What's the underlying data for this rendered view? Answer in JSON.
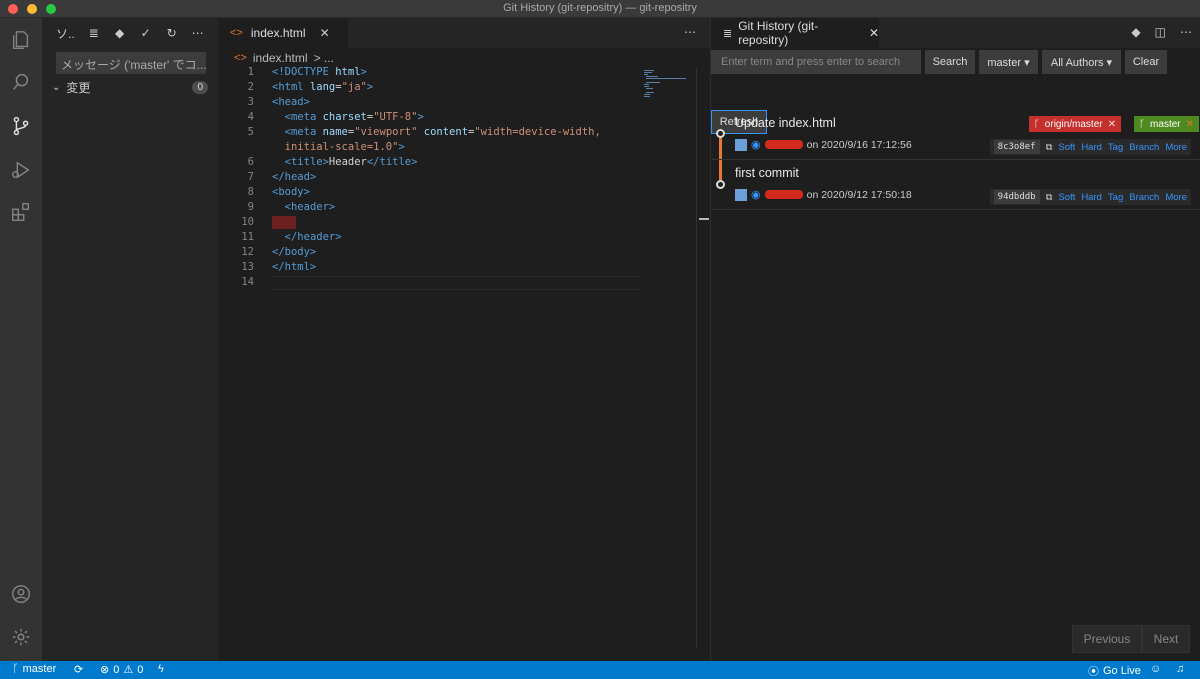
{
  "window": {
    "title": "Git History (git-repositry) — git-repositry"
  },
  "activity": {
    "icons": [
      "explorer-icon",
      "search-icon",
      "source-control-icon",
      "run-debug-icon",
      "extensions-icon",
      "account-icon",
      "settings-gear-icon"
    ]
  },
  "sidebar": {
    "header_label": "ソ..",
    "message_placeholder": "メッセージ ('master' でコ...",
    "changes_label": "変更",
    "changes_count": "0"
  },
  "editor": {
    "tab_label": "index.html",
    "breadcrumb_file": "index.html",
    "breadcrumb_more": "> ...",
    "lines": [
      {
        "n": "1",
        "html": "<span class='t'>&lt;!DOCTYPE</span> <span class='a'>html</span><span class='t'>&gt;</span>"
      },
      {
        "n": "2",
        "html": "<span class='t'>&lt;html</span> <span class='a'>lang</span>=<span class='s'>\"ja\"</span><span class='t'>&gt;</span>"
      },
      {
        "n": "3",
        "html": "<span class='t'>&lt;head&gt;</span>"
      },
      {
        "n": "4",
        "html": "  <span class='t'>&lt;meta</span> <span class='a'>charset</span>=<span class='s'>\"UTF-8\"</span><span class='t'>&gt;</span>"
      },
      {
        "n": "5",
        "html": "  <span class='t'>&lt;meta</span> <span class='a'>name</span>=<span class='s'>\"viewport\"</span> <span class='a'>content</span>=<span class='s'>\"width=device-width,</span>"
      },
      {
        "n": "",
        "html": "  <span class='s'>initial-scale=1.0\"</span><span class='t'>&gt;</span>"
      },
      {
        "n": "6",
        "html": "  <span class='t'>&lt;title&gt;</span>Header<span class='t'>&lt;/title&gt;</span>"
      },
      {
        "n": "7",
        "html": "<span class='t'>&lt;/head&gt;</span>"
      },
      {
        "n": "8",
        "html": "<span class='t'>&lt;body&gt;</span>"
      },
      {
        "n": "9",
        "html": "  <span class='t'>&lt;header&gt;</span>"
      },
      {
        "n": "10",
        "html": ""
      },
      {
        "n": "11",
        "html": "  <span class='t'>&lt;/header&gt;</span>"
      },
      {
        "n": "12",
        "html": "<span class='t'>&lt;/body&gt;</span>"
      },
      {
        "n": "13",
        "html": "<span class='t'>&lt;/html&gt;</span>"
      },
      {
        "n": "14",
        "html": ""
      }
    ]
  },
  "git": {
    "tab_label": "Git History (git-repositry)",
    "search_placeholder": "Enter term and press enter to search",
    "search_button": "Search",
    "branch_button": "master ▾",
    "authors_button": "All Authors ▾",
    "clear_button": "Clear",
    "refresh_button": "Refresh",
    "commits": [
      {
        "message": "Update index.html",
        "date": "on 2020/9/16 17:12:56",
        "hash": "8c3o8ef",
        "refs": [
          {
            "name": "origin/master",
            "color": "#c4302b"
          },
          {
            "name": "master",
            "color": "#4e8a1f"
          }
        ]
      },
      {
        "message": "first commit",
        "date": "on 2020/9/12 17:50:18",
        "hash": "94dbddb",
        "refs": []
      }
    ],
    "actions": {
      "soft": "Soft",
      "hard": "Hard",
      "tag": "Tag",
      "branch": "Branch",
      "more": "More"
    },
    "pager": {
      "previous": "Previous",
      "next": "Next"
    }
  },
  "status": {
    "branch": "master",
    "errors": "0",
    "warnings": "0",
    "go_live": "Go Live"
  }
}
